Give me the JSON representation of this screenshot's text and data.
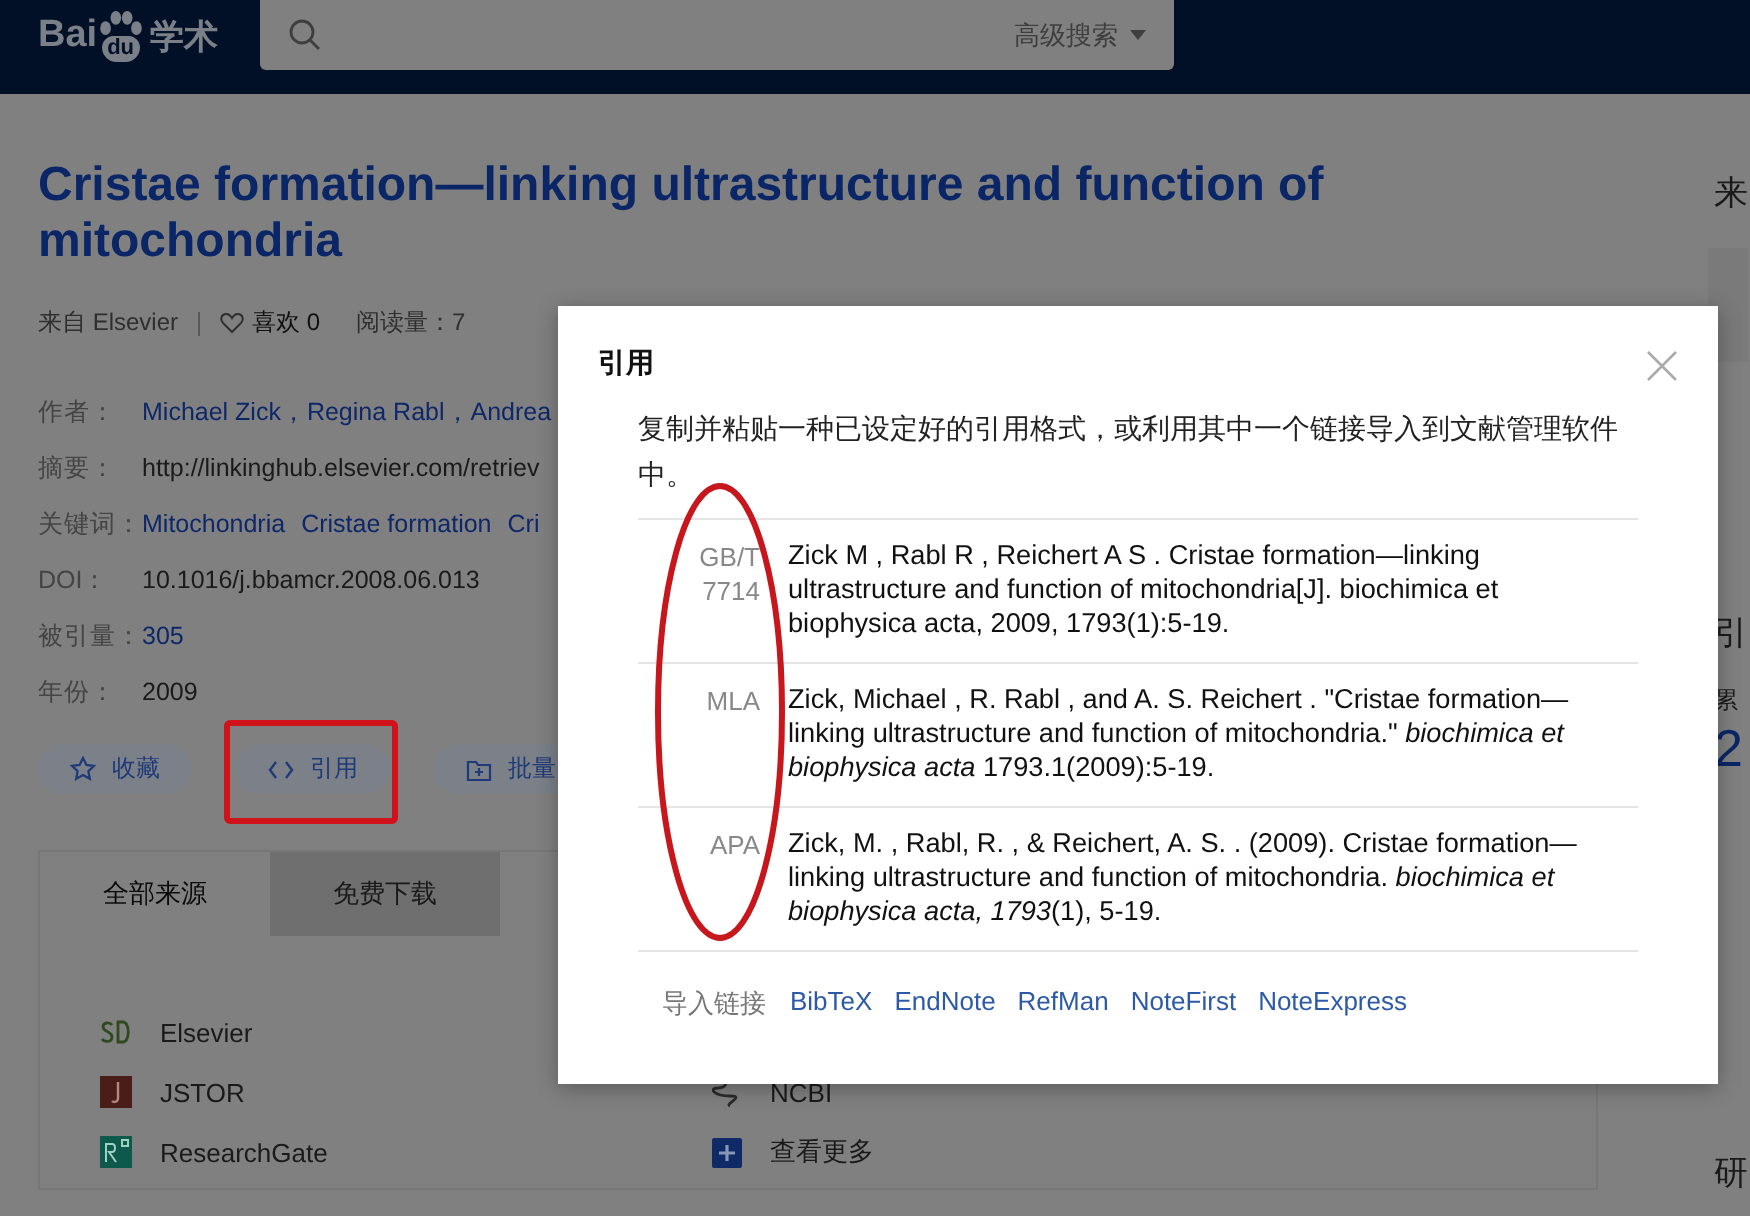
{
  "header": {
    "logo": {
      "left": "Bai",
      "middle": "du",
      "right": "学术"
    },
    "search": {
      "advanced": "高级搜索"
    }
  },
  "paper": {
    "title": "Cristae formation—linking ultrastructure and function of mitochondria",
    "source": "来自 Elsevier",
    "likes": "喜欢 0",
    "reads": "阅读量：7",
    "fields": [
      {
        "label": "作者：",
        "kind": "links",
        "values": [
          "Michael Zick，Regina Rabl，Andrea"
        ]
      },
      {
        "label": "摘要：",
        "kind": "text",
        "values": [
          "http://linkinghub.elsevier.com/retriev"
        ]
      },
      {
        "label": "关键词：",
        "kind": "links",
        "values": [
          "Mitochondria",
          "Cristae formation",
          "Cri"
        ]
      },
      {
        "label": "DOI：",
        "kind": "text",
        "values": [
          "10.1016/j.bbamcr.2008.06.013"
        ]
      },
      {
        "label": "被引量：",
        "kind": "links",
        "values": [
          "305"
        ]
      },
      {
        "label": "年份：",
        "kind": "text",
        "values": [
          "2009"
        ]
      }
    ],
    "actions": [
      {
        "label": "收藏"
      },
      {
        "label": "引用"
      },
      {
        "label": "批量"
      }
    ]
  },
  "sources": {
    "tabs": [
      {
        "label": "全部来源",
        "selected": true
      },
      {
        "label": "免费下载",
        "selected": false
      }
    ],
    "left": [
      {
        "name": "Elsevier"
      },
      {
        "name": "JSTOR"
      },
      {
        "name": "ResearchGate"
      }
    ],
    "right": [
      {
        "name": "NCBI"
      },
      {
        "name": "查看更多"
      }
    ]
  },
  "right_panel": {
    "heading": "来",
    "section_heading": "引",
    "label": "累",
    "count": "2",
    "bottom_heading": "研"
  },
  "dialog": {
    "title": "引用",
    "description": "复制并粘贴一种已设定好的引用格式，或利用其中一个链接导入到文献管理软件中。",
    "citations": [
      {
        "format": "GB/T 7714",
        "text": "Zick M , Rabl R , Reichert A S . Cristae formation—linking ultrastructure and function of mitochondria[J]. biochimica et biophysica acta, 2009, 1793(1):5-19."
      },
      {
        "format": "MLA",
        "text": "Zick, Michael , R. Rabl , and A. S. Reichert . \"Cristae formation—linking ultrastructure and function of mitochondria.\" *biochimica et biophysica acta* 1793.1(2009):5-19."
      },
      {
        "format": "APA",
        "text": "Zick, M. , Rabl, R. , & Reichert, A. S. . (2009). Cristae formation—linking ultrastructure and function of mitochondria. *biochimica et biophysica acta, 1793*(1), 5-19."
      }
    ],
    "import_label": "导入链接",
    "import_links": [
      "BibTeX",
      "EndNote",
      "RefMan",
      "NoteFirst",
      "NoteExpress"
    ]
  }
}
